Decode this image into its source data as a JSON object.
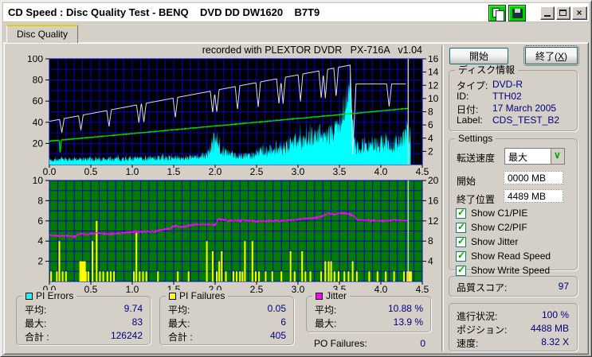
{
  "window": {
    "title": "CD Speed : Disc Quality Test - BENQ    DVD DD DW1620    B7T9",
    "controls": {
      "close_glyph": "×"
    }
  },
  "tab": {
    "label": "Disc Quality"
  },
  "chart_data": [
    {
      "type": "line",
      "title": "recorded with PLEXTOR DVDR   PX-716A   v1.04",
      "background": "#000000",
      "grid_color": "#0000cc",
      "x_axis": {
        "min": 0,
        "max": 4.5,
        "grid_step": 0.1,
        "ticks": [
          "0.0",
          "0.5",
          "1.0",
          "1.5",
          "2.0",
          "2.5",
          "3.0",
          "3.5",
          "4.0",
          "4.5"
        ]
      },
      "left_axis": {
        "min": 0,
        "max": 100,
        "grid_step": 10,
        "ticks": [
          100,
          80,
          60,
          40,
          20
        ]
      },
      "right_axis": {
        "min": 0,
        "max": 16,
        "ticks": [
          16,
          14,
          12,
          10,
          8,
          6,
          4,
          2
        ]
      },
      "series": [
        {
          "name": "PI Errors",
          "type": "noisy-area",
          "color": "#00ffff",
          "scale": "left",
          "seed": 7,
          "noise": 0.5,
          "end_x": 4.36,
          "anchors": [
            [
              0,
              4.5
            ],
            [
              0.3,
              5
            ],
            [
              0.6,
              5
            ],
            [
              0.9,
              5.5
            ],
            [
              1.2,
              6
            ],
            [
              1.5,
              6.5
            ],
            [
              1.8,
              7
            ],
            [
              1.9,
              9
            ],
            [
              1.97,
              20
            ],
            [
              2.03,
              22
            ],
            [
              2.08,
              15
            ],
            [
              2.15,
              10
            ],
            [
              2.3,
              8.5
            ],
            [
              2.45,
              9
            ],
            [
              2.55,
              13
            ],
            [
              2.7,
              13
            ],
            [
              2.85,
              18
            ],
            [
              2.95,
              22
            ],
            [
              3.0,
              24
            ],
            [
              3.05,
              20
            ],
            [
              3.12,
              23
            ],
            [
              3.2,
              28
            ],
            [
              3.28,
              31
            ],
            [
              3.33,
              25
            ],
            [
              3.42,
              31
            ],
            [
              3.5,
              38
            ],
            [
              3.55,
              46
            ],
            [
              3.6,
              62
            ],
            [
              3.63,
              83
            ],
            [
              3.66,
              45
            ],
            [
              3.69,
              18
            ],
            [
              3.75,
              17
            ],
            [
              3.85,
              20
            ],
            [
              3.95,
              18
            ],
            [
              4.05,
              21
            ],
            [
              4.15,
              19
            ],
            [
              4.25,
              22
            ],
            [
              4.3,
              28
            ],
            [
              4.33,
              34
            ],
            [
              4.36,
              20
            ]
          ]
        },
        {
          "name": "Write Speed",
          "type": "speed-line",
          "color": "#dcdcdc",
          "scale": "right",
          "start": 6.55,
          "peak": 15.05,
          "peak_x": 3.63,
          "valley": 1.5,
          "valley_x": 3.66,
          "recover_x": 3.7,
          "flat": 12.2,
          "end_x": 4.3,
          "dip_depth": 0.3,
          "dips": [
            0.15,
            0.38,
            0.72,
            1.08,
            1.14,
            1.52,
            1.97,
            2.02,
            2.27,
            2.52,
            2.77,
            2.82,
            3.03,
            3.28,
            3.33,
            3.46
          ],
          "late_dip": {
            "x": 4.1,
            "depth": 3.5
          }
        },
        {
          "name": "Read Speed",
          "type": "trend-line",
          "color": "#00dd00",
          "scale": "right",
          "seed": 5,
          "noise": 0.05,
          "start": 3.55,
          "end": 8.5,
          "end_x": 4.33,
          "spike": {
            "x": 0.13,
            "v": 1.6,
            "w": 0.013
          }
        },
        {
          "name": "position marker",
          "type": "vline",
          "color": "#c8c8c8",
          "x": 4.33
        }
      ]
    },
    {
      "type": "line",
      "title": "",
      "background": "#007c00",
      "grid_color": "#0000cc",
      "x_axis": {
        "min": 0,
        "max": 4.5,
        "grid_step": 0.1,
        "ticks": [
          "0.0",
          "0.5",
          "1.0",
          "1.5",
          "2.0",
          "2.5",
          "3.0",
          "3.5",
          "4.0",
          "4.5"
        ]
      },
      "left_axis": {
        "min": 0,
        "max": 10,
        "grid_step": 1,
        "ticks": [
          10,
          8,
          6,
          4,
          2
        ]
      },
      "right_axis": {
        "min": 0,
        "max": 20,
        "ticks": [
          20,
          16,
          12,
          8,
          4
        ]
      },
      "series": [
        {
          "name": "PI Failures",
          "type": "bars",
          "color": "#ffff00",
          "scale": "left",
          "bars": [
            [
              0.02,
              1
            ],
            [
              0.09,
              1
            ],
            [
              0.12,
              4
            ],
            [
              0.16,
              1
            ],
            [
              0.2,
              1
            ],
            [
              0.38,
              2
            ],
            [
              0.4,
              2,
              8
            ],
            [
              0.44,
              1
            ],
            [
              0.47,
              1
            ],
            [
              0.52,
              4
            ],
            [
              0.57,
              6
            ],
            [
              0.61,
              1
            ],
            [
              0.65,
              1
            ],
            [
              0.7,
              1
            ],
            [
              0.74,
              1
            ],
            [
              0.78,
              1
            ],
            [
              1.02,
              1
            ],
            [
              1.05,
              5
            ],
            [
              1.09,
              1
            ],
            [
              1.13,
              1
            ],
            [
              1.17,
              1
            ],
            [
              1.31,
              1
            ],
            [
              1.55,
              1
            ],
            [
              1.68,
              1
            ],
            [
              1.9,
              4
            ],
            [
              1.97,
              3
            ],
            [
              2.02,
              1
            ],
            [
              2.05,
              2
            ],
            [
              2.08,
              3
            ],
            [
              2.13,
              1
            ],
            [
              2.22,
              1
            ],
            [
              2.26,
              1
            ],
            [
              2.3,
              1
            ],
            [
              2.33,
              1
            ],
            [
              2.36,
              4
            ],
            [
              2.45,
              4
            ],
            [
              2.49,
              1
            ],
            [
              2.53,
              1
            ],
            [
              2.61,
              1
            ],
            [
              2.69,
              1
            ],
            [
              2.8,
              1
            ],
            [
              2.91,
              3
            ],
            [
              2.96,
              1
            ],
            [
              3.05,
              3
            ],
            [
              3.09,
              1
            ],
            [
              3.15,
              1
            ],
            [
              3.28,
              1
            ],
            [
              3.33,
              2
            ],
            [
              3.37,
              2
            ],
            [
              3.4,
              2
            ],
            [
              3.44,
              1
            ],
            [
              3.49,
              1
            ],
            [
              3.56,
              1
            ],
            [
              3.61,
              1
            ],
            [
              3.66,
              2
            ],
            [
              3.71,
              1
            ],
            [
              3.86,
              1
            ],
            [
              3.96,
              1
            ],
            [
              4.06,
              1
            ],
            [
              4.16,
              1
            ],
            [
              4.28,
              1
            ],
            [
              4.32,
              1
            ],
            [
              4.35,
              1,
              5
            ]
          ]
        },
        {
          "name": "Jitter",
          "type": "noisy-line",
          "color": "#ff00ff",
          "scale": "right",
          "seed": 11,
          "noise": 0.16,
          "end_x": 4.33,
          "anchors": [
            [
              0,
              9.2
            ],
            [
              0.1,
              9.0
            ],
            [
              0.2,
              9.1
            ],
            [
              0.3,
              8.9
            ],
            [
              0.38,
              9.5
            ],
            [
              0.45,
              9.3
            ],
            [
              0.52,
              9.5
            ],
            [
              0.6,
              9.6
            ],
            [
              0.7,
              9.4
            ],
            [
              0.8,
              9.5
            ],
            [
              0.9,
              9.7
            ],
            [
              1.0,
              9.8
            ],
            [
              1.1,
              9.9
            ],
            [
              1.25,
              9.9
            ],
            [
              1.35,
              10.2
            ],
            [
              1.45,
              10.5
            ],
            [
              1.52,
              11.0
            ],
            [
              1.6,
              10.8
            ],
            [
              1.7,
              11.1
            ],
            [
              1.8,
              11.3
            ],
            [
              1.9,
              11.3
            ],
            [
              2.0,
              11.2
            ],
            [
              2.04,
              12.4
            ],
            [
              2.1,
              12.2
            ],
            [
              2.2,
              12.0
            ],
            [
              2.35,
              12.1
            ],
            [
              2.5,
              11.9
            ],
            [
              2.65,
              12.0
            ],
            [
              2.8,
              12.0
            ],
            [
              2.95,
              12.2
            ],
            [
              3.1,
              12.5
            ],
            [
              3.2,
              12.6
            ],
            [
              3.3,
              13.0
            ],
            [
              3.38,
              13.5
            ],
            [
              3.44,
              13.2
            ],
            [
              3.52,
              13.6
            ],
            [
              3.6,
              13.4
            ],
            [
              3.66,
              13.1
            ],
            [
              3.72,
              12.2
            ],
            [
              3.85,
              12.1
            ],
            [
              4.0,
              12.0
            ],
            [
              4.15,
              12.1
            ],
            [
              4.33,
              12.1
            ]
          ]
        },
        {
          "name": "position marker",
          "type": "vline",
          "color": "#c8c8c8",
          "x": 4.33
        }
      ]
    }
  ],
  "right_panel": {
    "actions": {
      "start_label": "開始",
      "exit_prefix": "終了(",
      "exit_key": "X",
      "exit_suffix": ")"
    },
    "disc_info": {
      "title": "ディスク情報",
      "rows": [
        {
          "label": "タイプ:",
          "value": "DVD-R"
        },
        {
          "label": "ID:",
          "value": "TTH02"
        },
        {
          "label": "日付:",
          "value": "17 March 2005"
        },
        {
          "label": "Label:",
          "value": "CDS_TEST_B2"
        }
      ]
    },
    "settings": {
      "title": "Settings",
      "speed_label": "転送速度",
      "speed_value": "最大",
      "start_label": "開始",
      "start_value": "0000 MB",
      "end_label": "終了位置",
      "end_value": "4489 MB",
      "check_glyph": "✓",
      "checkboxes": [
        {
          "label": "Show C1/PIE",
          "checked": true
        },
        {
          "label": "Show C2/PIF",
          "checked": true
        },
        {
          "label": "Show Jitter",
          "checked": true
        },
        {
          "label": "Show Read Speed",
          "checked": true
        },
        {
          "label": "Show Write Speed",
          "checked": true
        }
      ]
    },
    "score": {
      "label": "品質スコア:",
      "value": "97"
    },
    "progress": {
      "rows": [
        {
          "label": "進行状況:",
          "value": "100 %"
        },
        {
          "label": "ポジション:",
          "value": "4488 MB"
        },
        {
          "label": "速度:",
          "value": "8.32 X"
        }
      ]
    }
  },
  "stats": {
    "groups": [
      {
        "title": "PI Errors",
        "swatch": "#00ffff",
        "rows": [
          {
            "label": "平均:",
            "value": "9.74"
          },
          {
            "label": "最大:",
            "value": "83"
          },
          {
            "label": "合計 :",
            "value": "126242"
          }
        ]
      },
      {
        "title": "PI Failures",
        "swatch": "#ffff00",
        "rows": [
          {
            "label": "平均:",
            "value": "0.05"
          },
          {
            "label": "最大:",
            "value": "6"
          },
          {
            "label": "合計 :",
            "value": "405"
          }
        ]
      },
      {
        "title": "Jitter",
        "swatch": "#ff00ff",
        "rows": [
          {
            "label": "平均:",
            "value": "10.88 %"
          },
          {
            "label": "最大:",
            "value": "13.9 %"
          }
        ]
      }
    ],
    "po_failures": {
      "label": "PO Failures:",
      "value": "0"
    }
  }
}
